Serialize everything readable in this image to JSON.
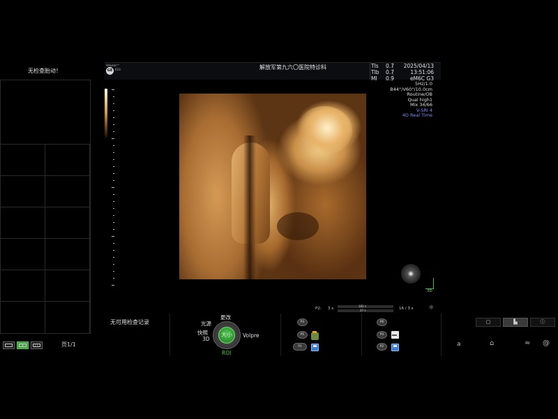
{
  "left_panel": {
    "title": "无检查胎动！",
    "page_indicator": "页1/1"
  },
  "header": {
    "logo": {
      "brand_top": "Voluson™",
      "brand_mark": "GE",
      "model": "E10"
    },
    "facility": "解放军第九六〇医院特诊科",
    "tis_params": [
      {
        "label": "TIs",
        "value": "0.7"
      },
      {
        "label": "TIb",
        "value": "0.7"
      },
      {
        "label": "MI",
        "value": "0.9"
      }
    ],
    "date": "2025/04/13",
    "time": "13:51:06",
    "probe": "eM6C G3"
  },
  "scan_info": {
    "freq": "5Hz/1.0",
    "angles": "B44°/V60°/10.0cm",
    "preset": "Routine/OB",
    "quality": "Qual high1",
    "mix": "Mix 34/66",
    "vsri": "V-SRI 4",
    "mode": "4D Real Time"
  },
  "orientation": {
    "axis_label": "3D"
  },
  "cine": {
    "label": "P2:",
    "start": "3 s",
    "track_top": "182 s",
    "track_bottom": "37 s",
    "frame": "16 / 3 s"
  },
  "bottom": {
    "no_records": "无可用检查记录",
    "knob": {
      "center": "大小",
      "top": "更改",
      "upper_left": "光源",
      "left": "快照",
      "lower_left": "3D",
      "right": "Volpre",
      "bottom": "ROI"
    },
    "buttons_left": [
      "P3",
      "P5",
      "P1"
    ],
    "buttons_right": [
      "P6",
      "P4",
      "P2"
    ]
  },
  "colors": {
    "accent_green": "#3fd13f",
    "info_blue": "#7f8cff"
  }
}
